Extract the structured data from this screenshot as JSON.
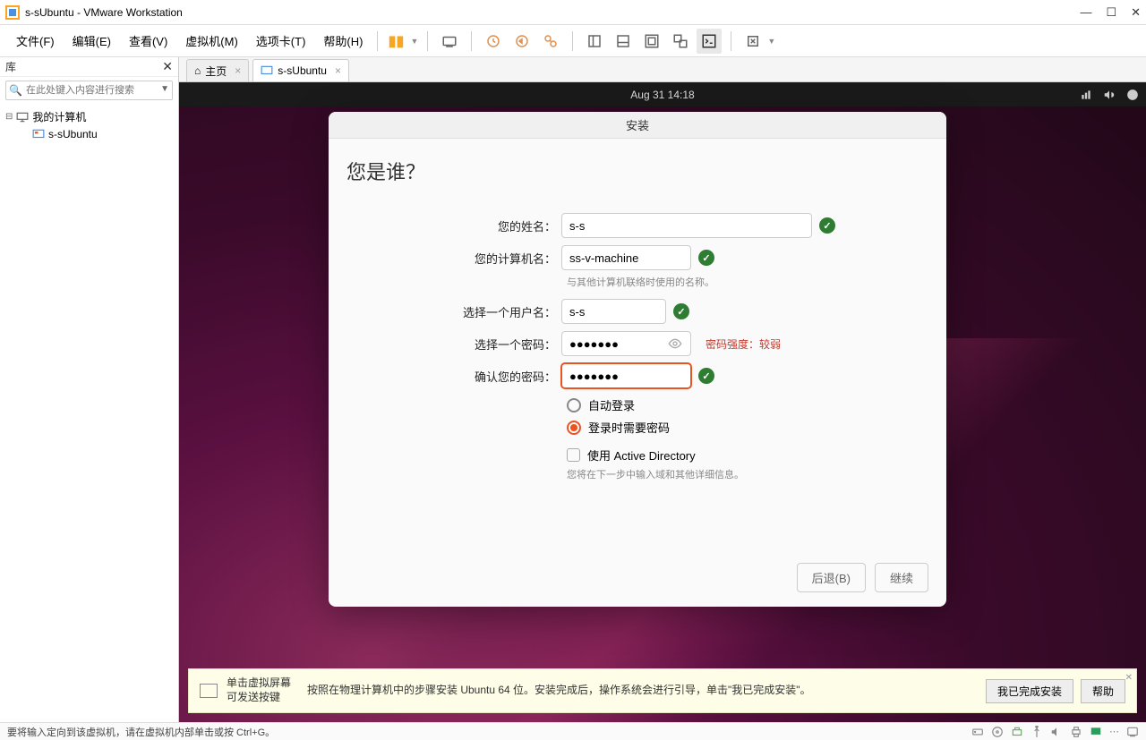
{
  "titlebar": {
    "title": "s-sUbuntu - VMware Workstation"
  },
  "menubar": {
    "items": [
      "文件(F)",
      "编辑(E)",
      "查看(V)",
      "虚拟机(M)",
      "选项卡(T)",
      "帮助(H)"
    ]
  },
  "sidebar": {
    "title": "库",
    "search_placeholder": "在此处键入内容进行搜索",
    "root": "我的计算机",
    "child": "s-sUbuntu"
  },
  "tabs": {
    "home": "主页",
    "vm": "s-sUbuntu"
  },
  "ubuntu": {
    "clock": "Aug 31  14:18",
    "installer": {
      "header": "安装",
      "title": "您是谁？",
      "name_label": "您的姓名：",
      "name_value": "s-s",
      "host_label": "您的计算机名：",
      "host_value": "ss-v-machine",
      "host_hint": "与其他计算机联络时使用的名称。",
      "user_label": "选择一个用户名：",
      "user_value": "s-s",
      "pw_label": "选择一个密码：",
      "pw_value": "●●●●●●●",
      "pw_strength": "密码强度：较弱",
      "pw2_label": "确认您的密码：",
      "pw2_value": "●●●●●●●",
      "auto_login": "自动登录",
      "require_pw": "登录时需要密码",
      "use_ad": "使用 Active Directory",
      "ad_hint": "您将在下一步中输入域和其他详细信息。",
      "back": "后退(B)",
      "continue": "继续"
    }
  },
  "infobar": {
    "hint_title": "单击虚拟屏幕",
    "hint_sub": "可发送按键",
    "message": "按照在物理计算机中的步骤安装 Ubuntu 64 位。安装完成后，操作系统会进行引导，单击\"我已完成安装\"。",
    "done": "我已完成安装",
    "help": "帮助"
  },
  "statusbar": {
    "text": "要将输入定向到该虚拟机，请在虚拟机内部单击或按 Ctrl+G。"
  }
}
